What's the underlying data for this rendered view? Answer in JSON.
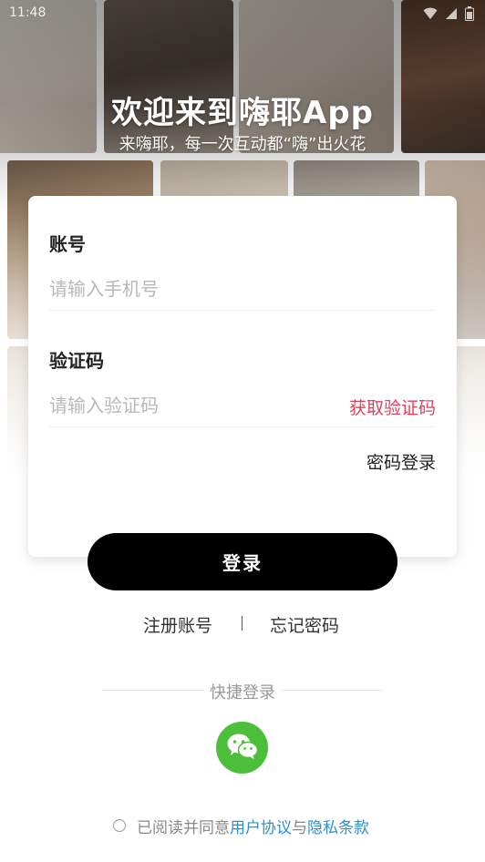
{
  "status_bar": {
    "time": "11:48"
  },
  "hero": {
    "title": "欢迎来到嗨耶App",
    "subtitle": "来嗨耶，每一次互动都“嗨”出火花"
  },
  "form": {
    "account_label": "账号",
    "phone_placeholder": "请输入手机号",
    "phone_value": "",
    "code_label": "验证码",
    "code_placeholder": "请输入验证码",
    "code_value": "",
    "get_code_label": "获取验证码",
    "password_login_label": "密码登录"
  },
  "login_button": {
    "label": "登录"
  },
  "links": {
    "register": "注册账号",
    "divider": "|",
    "forgot": "忘记密码"
  },
  "quick_login": {
    "label": "快捷登录",
    "icon": "wechat-icon"
  },
  "agreement": {
    "checked": false,
    "prefix": "已阅读并同意",
    "user_agreement": "用户协议",
    "conjunction": "与",
    "privacy_policy": "隐私条款"
  },
  "colors": {
    "accent_red": "#e0405a",
    "link_blue": "#2a8fd6",
    "wechat_green": "#4cbf3a",
    "button_black": "#000000"
  }
}
